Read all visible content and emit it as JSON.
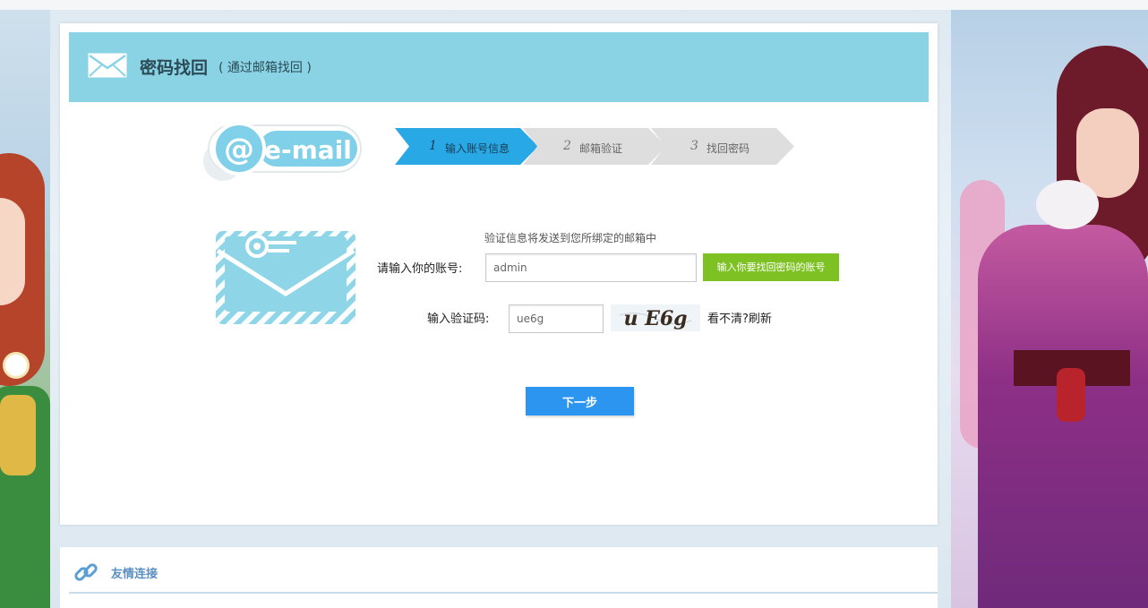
{
  "header": {
    "title": "密码找回",
    "subtitle": "( 通过邮箱找回 )",
    "icon": "envelope-icon"
  },
  "logo": {
    "text": "e-mail",
    "at": "@"
  },
  "steps": [
    {
      "num": "1",
      "label": "输入账号信息",
      "active": true
    },
    {
      "num": "2",
      "label": "邮箱验证",
      "active": false
    },
    {
      "num": "3",
      "label": "找回密码",
      "active": false
    }
  ],
  "form": {
    "hint": "验证信息将发送到您所绑定的邮箱中",
    "account_label": "请输入你的账号:",
    "account_value": "admin",
    "account_tip": "输入你要找回密码的账号",
    "code_label": "输入验证码:",
    "code_value": "ue6g",
    "captcha_text": "u E6g",
    "refresh": "看不清?刷新",
    "next": "下一步"
  },
  "links": {
    "title": "友情连接",
    "icon": "link-icon"
  },
  "colors": {
    "header_bg": "#89d3e5",
    "step_active": "#29a8e6",
    "step_inactive": "#dedede",
    "tip_green": "#7dc122",
    "button_blue": "#2c95ef",
    "link_title": "#5a8fbf"
  }
}
